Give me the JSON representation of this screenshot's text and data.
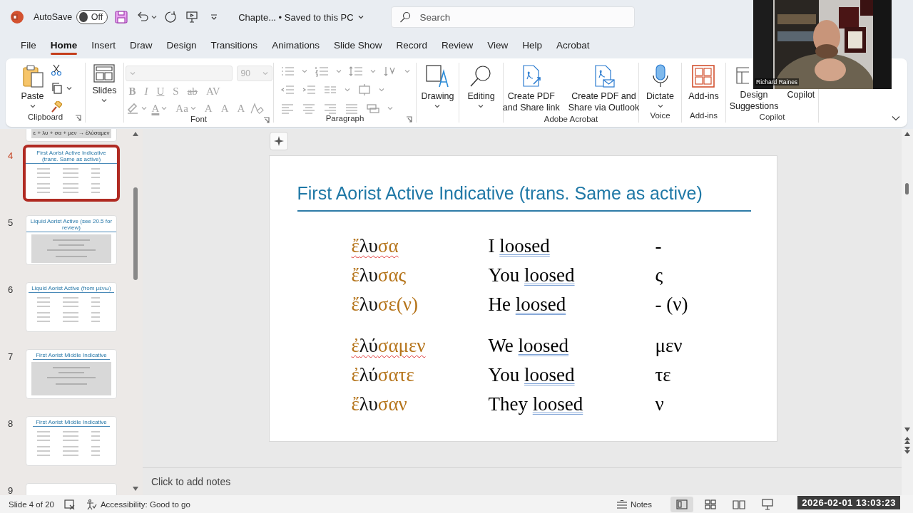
{
  "title_bar": {
    "autosave_label": "AutoSave",
    "autosave": {
      "on": false,
      "label": "Off"
    },
    "document": "Chapte... • Saved to this PC",
    "search": {
      "placeholder": "Search"
    }
  },
  "tabs": [
    {
      "label": "File",
      "selected": false
    },
    {
      "label": "Home",
      "selected": true
    },
    {
      "label": "Insert",
      "selected": false
    },
    {
      "label": "Draw",
      "selected": false
    },
    {
      "label": "Design",
      "selected": false
    },
    {
      "label": "Transitions",
      "selected": false
    },
    {
      "label": "Animations",
      "selected": false
    },
    {
      "label": "Slide Show",
      "selected": false
    },
    {
      "label": "Record",
      "selected": false
    },
    {
      "label": "Review",
      "selected": false
    },
    {
      "label": "View",
      "selected": false
    },
    {
      "label": "Help",
      "selected": false
    },
    {
      "label": "Acrobat",
      "selected": false
    }
  ],
  "ribbon": {
    "groups": [
      {
        "kind": "clipboard",
        "label": "Clipboard",
        "button": "Paste"
      },
      {
        "kind": "slides",
        "button": "Slides"
      },
      {
        "kind": "font",
        "label": "Font",
        "disabled": true,
        "size": "90",
        "row1": [
          "B",
          "I",
          "U",
          "S",
          "ab",
          "AV"
        ],
        "row2": [
          "A",
          "Aa",
          "A",
          "A",
          "A"
        ]
      },
      {
        "kind": "paragraph",
        "label": "Paragraph"
      },
      {
        "kind": "buttons",
        "buttons": [
          {
            "kind": "drawing",
            "label": "Drawing",
            "menu": true
          }
        ]
      },
      {
        "kind": "buttons",
        "buttons": [
          {
            "kind": "editing",
            "label": "Editing",
            "menu": true
          }
        ]
      },
      {
        "kind": "buttons",
        "label": "Adobe Acrobat",
        "buttons": [
          {
            "kind": "pdf-link",
            "label": "Create PDF\nand Share link",
            "menu": false
          },
          {
            "kind": "pdf-mail",
            "label": "Create PDF and\nShare via Outlook",
            "menu": false
          }
        ]
      },
      {
        "kind": "buttons",
        "label": "Voice",
        "buttons": [
          {
            "kind": "dictate",
            "label": "Dictate",
            "menu": true
          }
        ]
      },
      {
        "kind": "buttons",
        "label": "Add-ins",
        "buttons": [
          {
            "kind": "addins",
            "label": "Add-ins",
            "menu": false
          }
        ]
      },
      {
        "kind": "buttons",
        "label": "Copilot",
        "buttons": [
          {
            "kind": "design",
            "label": "Design\nSuggestions",
            "menu": false
          },
          {
            "kind": "copilot",
            "label": "Copilot",
            "menu": false
          }
        ]
      }
    ]
  },
  "slides": [
    {
      "kind": "tail",
      "caption": "ε + λυ + σα + μεν → ἐλύσαμεν",
      "selected": false
    },
    {
      "kind": "table",
      "number": "4",
      "title": "First Aorist Active Indicative (trans. Same as active)",
      "selected": true
    },
    {
      "kind": "box",
      "number": "5",
      "title": "Liquid Aorist Active (see 20.5 for review)",
      "selected": false
    },
    {
      "kind": "table",
      "number": "6",
      "title": "Liquid Aorist Active (from μένω)",
      "selected": false
    },
    {
      "kind": "box",
      "number": "7",
      "title": "First Aorist Middle Indicative",
      "selected": false
    },
    {
      "kind": "table",
      "number": "8",
      "title": "First Aorist Middle Indicative",
      "selected": false
    },
    {
      "kind": "head",
      "number": "9",
      "selected": false
    }
  ],
  "slide": {
    "title": "First Aorist Active Indicative (trans. Same as active)",
    "groups": [
      [
        {
          "augment": "ἔ",
          "stem": "λυ",
          "ending": "σα",
          "flagged": true,
          "subject": "I",
          "verb": "loosed",
          "suffix": "-"
        },
        {
          "augment": "ἔ",
          "stem": "λυ",
          "ending": "σας",
          "flagged": false,
          "subject": "You",
          "verb": "loosed",
          "suffix": "ς"
        },
        {
          "augment": "ἔ",
          "stem": "λυ",
          "ending": "σε(ν)",
          "flagged": false,
          "subject": "He",
          "verb": "loosed",
          "suffix": "- (ν)"
        }
      ],
      [
        {
          "augment": "ἐ",
          "stem": "λύ",
          "ending": "σαμεν",
          "flagged": true,
          "subject": "We",
          "verb": "loosed",
          "suffix": "μεν"
        },
        {
          "augment": "ἐ",
          "stem": "λύ",
          "ending": "σατε",
          "flagged": false,
          "subject": "You",
          "verb": "loosed",
          "suffix": "τε"
        },
        {
          "augment": "ἔ",
          "stem": "λυ",
          "ending": "σαν",
          "flagged": false,
          "subject": "They",
          "verb": "loosed",
          "suffix": "ν"
        }
      ]
    ]
  },
  "notes": {
    "placeholder": "Click to add notes"
  },
  "status_bar": {
    "slide": "Slide 4 of 20",
    "accessibility": "Accessibility: Good to go",
    "notes": "Notes",
    "views": [
      {
        "kind": "normal",
        "selected": true
      },
      {
        "kind": "sorter",
        "selected": false
      },
      {
        "kind": "reading",
        "selected": false
      },
      {
        "kind": "slideshow",
        "selected": false
      }
    ]
  },
  "webcam": {
    "name": "Richard Raines"
  },
  "timestamp": "2026-02-01 13:03:23"
}
